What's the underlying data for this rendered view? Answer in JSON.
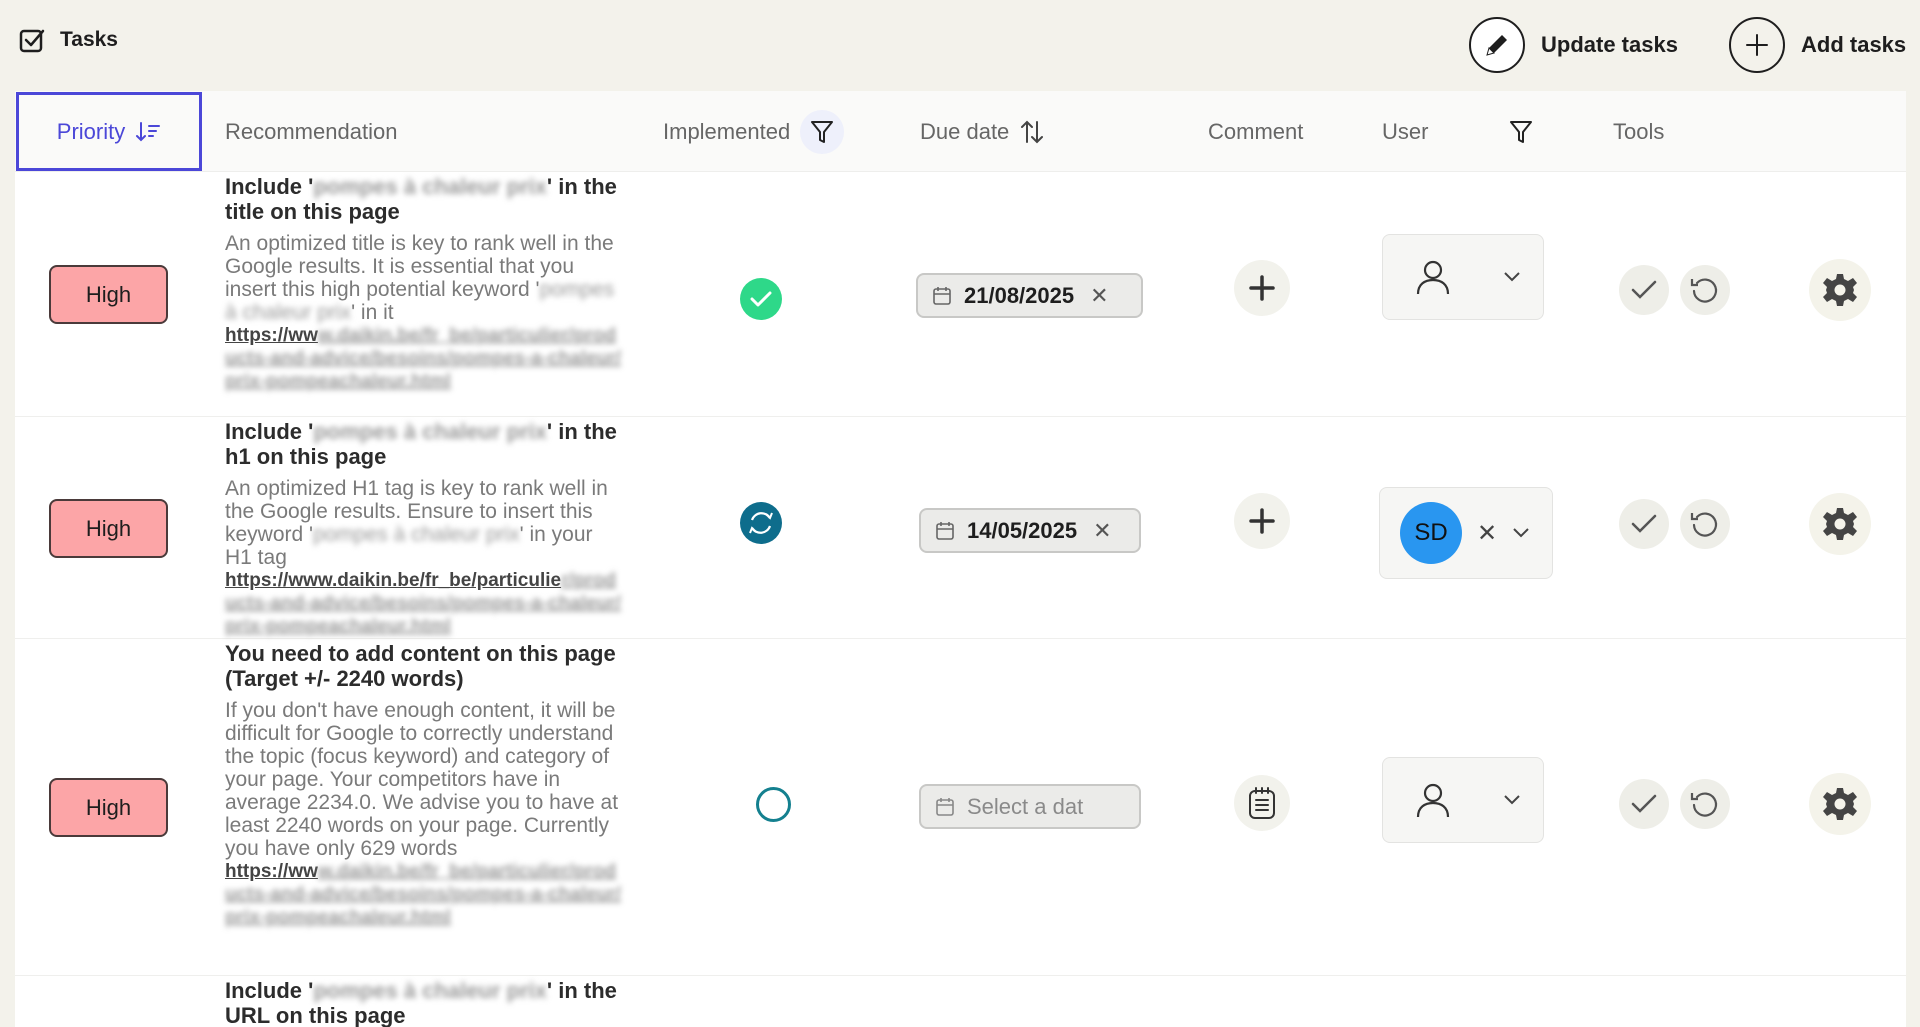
{
  "header": {
    "title": "Tasks",
    "update_label": "Update tasks",
    "add_label": "Add tasks"
  },
  "columns": {
    "priority": "Priority",
    "recommendation": "Recommendation",
    "implemented": "Implemented",
    "due_date": "Due date",
    "comment": "Comment",
    "user": "User",
    "tools": "Tools"
  },
  "rows": [
    {
      "priority": "High",
      "title_pre": "Include '",
      "title_blur": "pompes à chaleur prix",
      "title_post": "' in the title on this page",
      "desc_pre": "An optimized title is key to rank well in the Google results. It is essential that you insert this high potential keyword '",
      "desc_blur": "pompes à chaleur prix",
      "desc_post": "' in it",
      "link_pre": "https://ww",
      "link_blur": "w.daikin.be/fr_be/particulier/products-and-advice/besoins/pompes-a-chaleur/prix-pompeachaleur.html",
      "status": "done",
      "due_date": "21/08/2025",
      "user_initials": ""
    },
    {
      "priority": "High",
      "title_pre": "Include '",
      "title_blur": "pompes à chaleur prix",
      "title_post": "' in the h1 on this page",
      "desc_pre": "An optimized H1 tag is key to rank well in the Google results. Ensure to insert this keyword '",
      "desc_blur": "pompes à chaleur prix",
      "desc_post": "' in your H1 tag",
      "link_pre": "https://www.daikin.be/fr_be/particulie",
      "link_blur": "r/products-and-advice/besoins/pompes-a-chaleur/prix-pompeachaleur.html",
      "status": "in-progress",
      "due_date": "14/05/2025",
      "user_initials": "SD"
    },
    {
      "priority": "High",
      "title_pre": "You need to add content on this page (Target +/- 2240 words)",
      "title_blur": "",
      "title_post": "",
      "desc_pre": "If you don't have enough content, it will be difficult for Google to correctly understand the topic (focus keyword) and category of your page. Your competitors have in average 2234.0. We advise you to have at least 2240 words on your page. Currently you have only 629 words",
      "desc_blur": "",
      "desc_post": "",
      "link_pre": "https://ww",
      "link_blur": "w.daikin.be/fr_be/particulier/products-and-advice/besoins/pompes-a-chaleur/prix-pompeachaleur.html",
      "status": "todo",
      "due_date_placeholder": "Select a dat",
      "user_initials": ""
    },
    {
      "title_pre": "Include '",
      "title_blur": "pompes à chaleur prix",
      "title_post": "' in the URL on this page"
    }
  ],
  "icons": {
    "brand": "checkbox-icon",
    "update": "pencil-icon",
    "add": "plus-circle-icon"
  },
  "colors": {
    "accent": "#4b47d8",
    "priority_high": "#fca5a7",
    "done": "#2ed889",
    "in_progress": "#0e6d8c",
    "avatar": "#2996f0"
  }
}
